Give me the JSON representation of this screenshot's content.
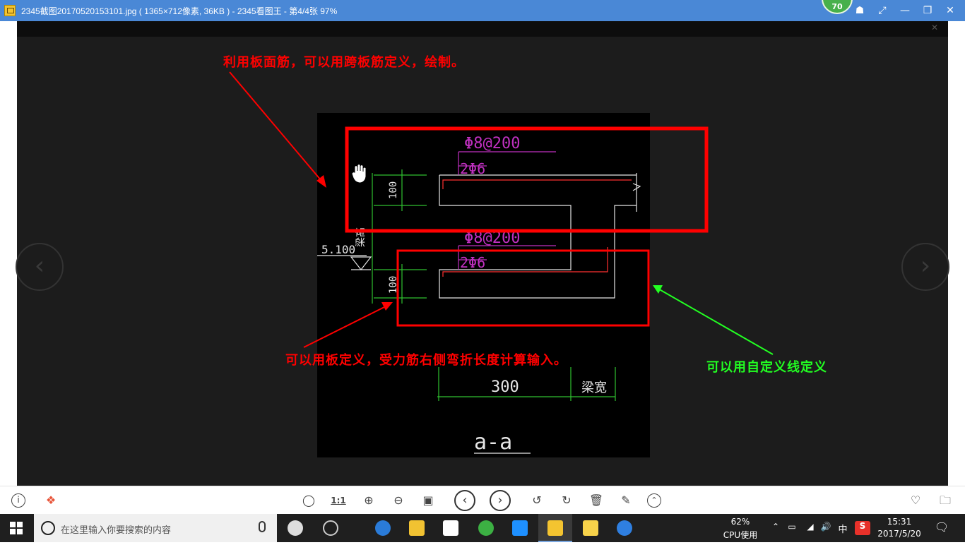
{
  "window": {
    "title": "2345截图20170520153101.jpg ( 1365×712像素, 36KB ) - 2345看图王 - 第4/4张 97%",
    "score": "70"
  },
  "drawing": {
    "dim_top_bar": "Φ8@200",
    "dim_top_dist": "2Φ6",
    "dim_mid_bar": "Φ8@200",
    "dim_mid_dist": "2Φ6",
    "elevation": "5.100",
    "dim_100_top": "100",
    "dim_100_bottom": "100",
    "dim_300": "300",
    "beam_width": "梁宽",
    "beam_height": "梁高",
    "section_label": "a-a"
  },
  "annotations": {
    "top": "利用板面筋，可以用跨板筋定义，绘制。",
    "bottom": "可以用板定义，受力筋右侧弯折长度计算输入。",
    "right": "可以用自定义线定义",
    "colors": {
      "red": "#ff0000",
      "green": "#22ff22"
    }
  },
  "taskbar": {
    "search_placeholder": "在这里输入你要搜索的内容",
    "cpu_percent": "62%",
    "cpu_label": "CPU使用",
    "ime": "中",
    "time": "15:31",
    "date": "2017/5/20"
  },
  "toolbar": {
    "actual_size": "1:1"
  }
}
